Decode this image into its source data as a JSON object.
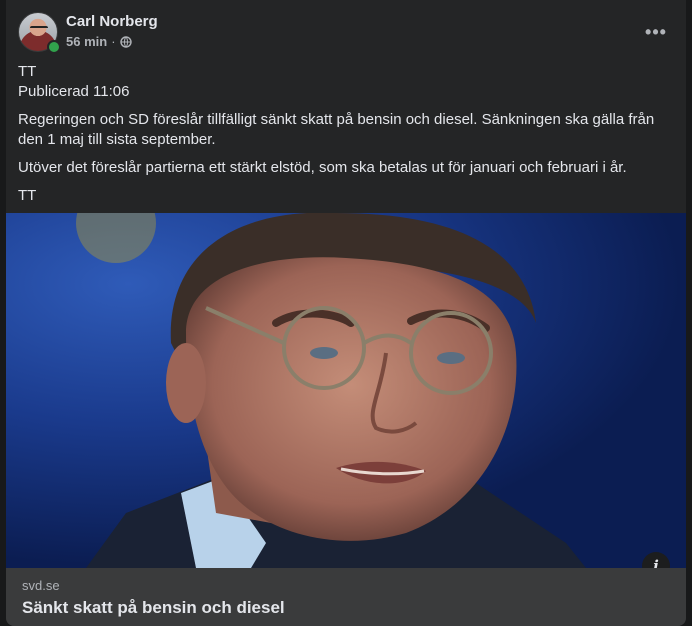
{
  "post": {
    "author": "Carl Norberg",
    "time": "56 min",
    "separator": "·",
    "audience_icon": "globe-icon",
    "more_icon": "more-options-icon",
    "more_label": "•••",
    "body": {
      "line1": "TT",
      "line2": "Publicerad 11:06",
      "para1": "Regeringen och SD föreslår tillfälligt sänkt skatt på bensin och diesel. Sänkningen ska gälla från den 1 maj till sista september.",
      "para2": "Utöver det föreslår partierna ett stärkt elstöd, som ska betalas ut för januari och februari i år.",
      "line3": "TT"
    },
    "link": {
      "domain": "svd.se",
      "title": "Sänkt skatt på bensin och diesel",
      "info_label": "i"
    },
    "colors": {
      "card": "#242526",
      "online": "#31a24c",
      "preview": "#3a3b3c"
    }
  }
}
